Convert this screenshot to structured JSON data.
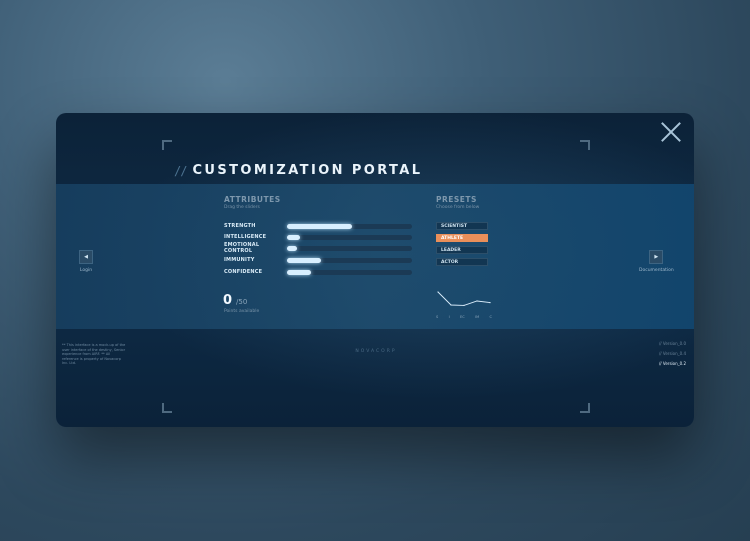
{
  "header": {
    "title_prefix": "//",
    "title": "CUSTOMIZATION PORTAL"
  },
  "nav": {
    "prev_label": "Login",
    "next_label": "Documentation",
    "prev_icon": "arrow-left-icon",
    "next_icon": "arrow-right-icon"
  },
  "attributes": {
    "title": "ATTRIBUTES",
    "subtitle": "Drag the sliders",
    "items": [
      {
        "label": "STRENGTH",
        "value": 0.52
      },
      {
        "label": "INTELLIGENCE",
        "value": 0.1
      },
      {
        "label": "EMOTIONAL CONTROL",
        "value": 0.08
      },
      {
        "label": "IMMUNITY",
        "value": 0.27
      },
      {
        "label": "CONFIDENCE",
        "value": 0.19
      }
    ]
  },
  "points": {
    "value": "0",
    "total": "/50",
    "label": "Points available"
  },
  "presets": {
    "title": "PRESETS",
    "subtitle": "Choose from below",
    "items": [
      {
        "label": "SCIENTIST",
        "active": false
      },
      {
        "label": "ATHLETE",
        "active": true
      },
      {
        "label": "LEADER",
        "active": false
      },
      {
        "label": "ACTOR",
        "active": false
      }
    ],
    "accent_color": "#e98f5a"
  },
  "chart_data": {
    "type": "line",
    "categories": [
      "S",
      "I",
      "EC",
      "IM",
      "C"
    ],
    "values": [
      85,
      20,
      18,
      40,
      32
    ],
    "ylim": [
      0,
      100
    ]
  },
  "footer": {
    "disclaimer": "** This interface is a mock-up of the user interface of the destiny, Senior experience from AIRF. ** All reference is property of Novacorp Inc. Ltd.",
    "brand": "NOVACORP",
    "versions": [
      {
        "label": "// Version_0.0",
        "current": false
      },
      {
        "label": "// Version_0.4",
        "current": false
      },
      {
        "label": "// Version_0.2",
        "current": true
      }
    ]
  },
  "close_icon": "close-icon"
}
